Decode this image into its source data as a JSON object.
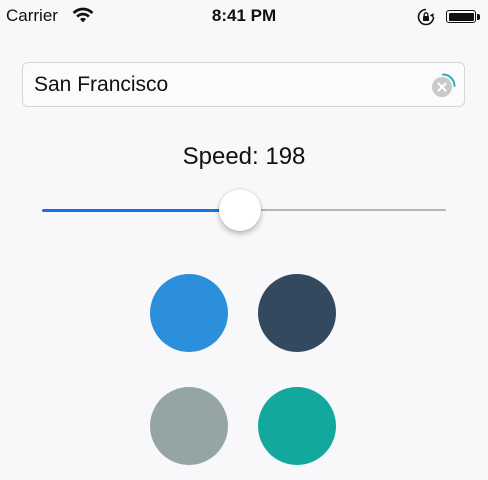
{
  "status_bar": {
    "carrier": "Carrier",
    "time": "8:41 PM",
    "icons": [
      "wifi-icon",
      "orientation-lock-icon",
      "battery-icon"
    ]
  },
  "search": {
    "value": "San Francisco",
    "clear_icon": "clear-circle-icon"
  },
  "speed": {
    "label": "Speed: 198",
    "slider_fraction": 0.49,
    "min_track_color": "#1473e6",
    "max_track_color": "#b5b5b5"
  },
  "colors": [
    "#2b8fdc",
    "#34495e",
    "#95a5a6",
    "#13a89e"
  ]
}
